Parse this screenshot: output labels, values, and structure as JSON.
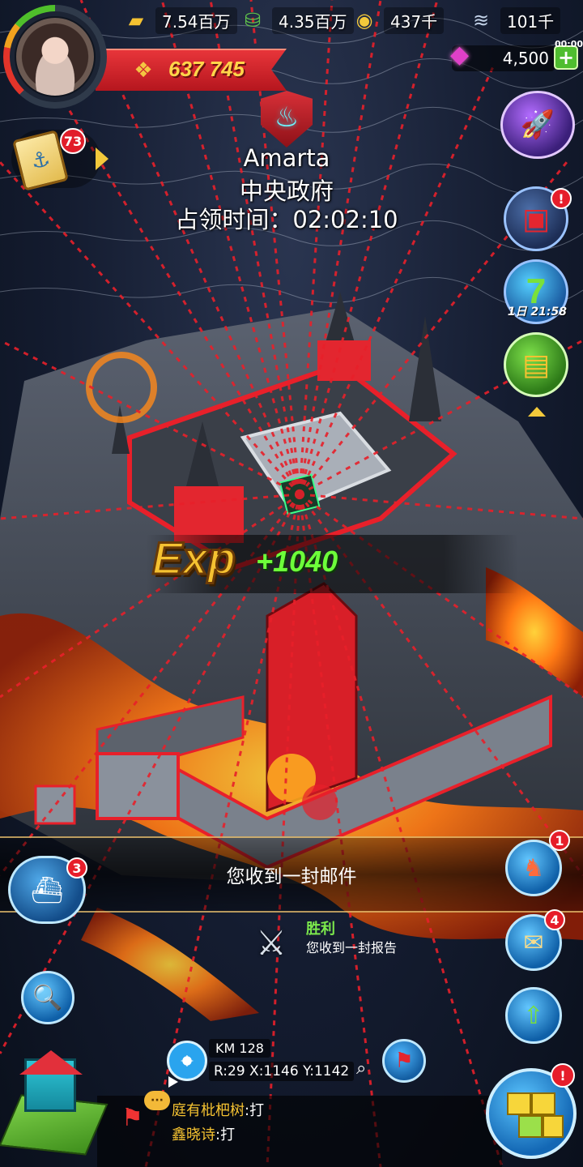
{
  "hud": {
    "power": "637 745",
    "resources": [
      {
        "icon": "gold-bars-icon",
        "value": "7.54百万"
      },
      {
        "icon": "oil-barrel-icon",
        "value": "4.35百万"
      },
      {
        "icon": "steel-coin-icon",
        "value": "437千"
      },
      {
        "icon": "alloy-stack-icon",
        "value": "101千"
      }
    ],
    "gems": "4,500",
    "gem_timer": "00:00",
    "quest_badge": "73"
  },
  "city": {
    "owner": "Amarta",
    "title": "中央政府",
    "occupy": "占领时间：02:02:10"
  },
  "side": {
    "gift_alert": "!",
    "seven_day_timer": "1日 21:58",
    "hero_alert": "1",
    "mail_alert": "4",
    "build_alert": "!",
    "fleet_badge": "3"
  },
  "exp": {
    "word": "Exp",
    "gain": "+1040"
  },
  "mail": {
    "notice": "您收到一封邮件",
    "report_title": "胜利",
    "report_sub": "您收到一封报告"
  },
  "coords": {
    "server": "KM 128",
    "position": "R:29 X:1146 Y:1142"
  },
  "chat": [
    {
      "user": "庭有枇杷树",
      "text": ":打"
    },
    {
      "user": "鑫晓诗",
      "text": ":打"
    }
  ],
  "colors": {
    "attack_lines": "#e8202a",
    "lava": "#ff7a14",
    "power_gold": "#ffd54a",
    "exp_green": "#6dff3a"
  }
}
